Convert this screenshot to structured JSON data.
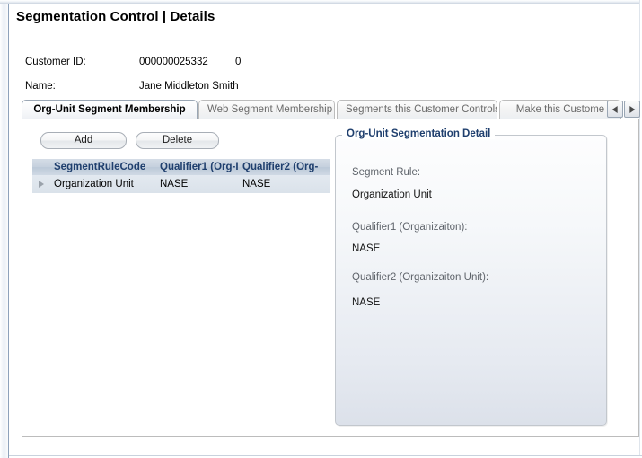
{
  "window": {
    "title": "Segmentation Control  |  Details"
  },
  "customer": {
    "id_label": "Customer ID:",
    "id_value": "000000025332",
    "id_suffix": "0",
    "name_label": "Name:",
    "name_value": "Jane Middleton Smith"
  },
  "tabs": {
    "items": [
      {
        "label": "Org-Unit Segment Membership",
        "active": true
      },
      {
        "label": "Web Segment Membership",
        "active": false
      },
      {
        "label": "Segments this Customer Controls",
        "active": false
      },
      {
        "label": "Make this Custome",
        "active": false
      }
    ],
    "scroll_left_icon": "triangle-left-icon",
    "scroll_right_icon": "triangle-right-icon"
  },
  "toolbar": {
    "add_label": "Add",
    "delete_label": "Delete"
  },
  "grid": {
    "columns": [
      "",
      "SegmentRuleCode",
      "Qualifier1 (Org-I",
      "Qualifier2 (Org-"
    ],
    "rows": [
      {
        "indicator": "row-selector-triangle",
        "SegmentRuleCode": "Organization Unit",
        "Qualifier1": "NASE",
        "Qualifier2": "NASE"
      }
    ]
  },
  "detail": {
    "legend": "Org-Unit Segmentation Detail",
    "fields": [
      {
        "label": "Segment Rule:",
        "value": "Organization Unit"
      },
      {
        "label": "Qualifier1 (Organizaiton):",
        "value": "NASE"
      },
      {
        "label": "Qualifier2 (Organizaiton Unit):",
        "value": "NASE"
      }
    ]
  },
  "colors": {
    "header_text": "#1f3f6e",
    "grid_header_bg": "#c6d1de",
    "grid_row_bg": "#dee5ed",
    "panel_border": "#c2c7cd",
    "rail": "#8ea2bb"
  }
}
